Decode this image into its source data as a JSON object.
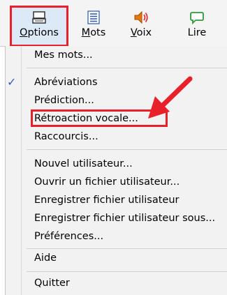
{
  "toolbar": {
    "options": {
      "label_underlined": "O",
      "label_rest": "ptions",
      "icon": "keyboard-icon"
    },
    "mots": {
      "label_underlined": "M",
      "label_rest": "ots",
      "icon": "list-icon"
    },
    "voix": {
      "label_underlined": "V",
      "label_rest": "oix",
      "icon": "speaker-icon"
    },
    "lire": {
      "label": "Lire",
      "icon": "speech-bubble-icon"
    }
  },
  "menu": {
    "mes_mots": "Mes mots...",
    "abreviations": "Abréviations",
    "abreviations_checked": true,
    "prediction": "Prédiction...",
    "retroaction": "Rétroaction vocale...",
    "raccourcis": "Raccourcis...",
    "nouvel_utilisateur": "Nouvel utilisateur...",
    "ouvrir": "Ouvrir un fichier utilisateur...",
    "enregistrer": "Enregistrer fichier utilisateur",
    "enregistrer_sous": "Enregistrer fichier utilisateur sous...",
    "preferences": "Préférences...",
    "aide": "Aide",
    "quitter": "Quitter"
  },
  "colors": {
    "highlight_red": "#e8202a",
    "check_blue": "#2f5fb3",
    "selected_bg": "#dce9f7"
  }
}
